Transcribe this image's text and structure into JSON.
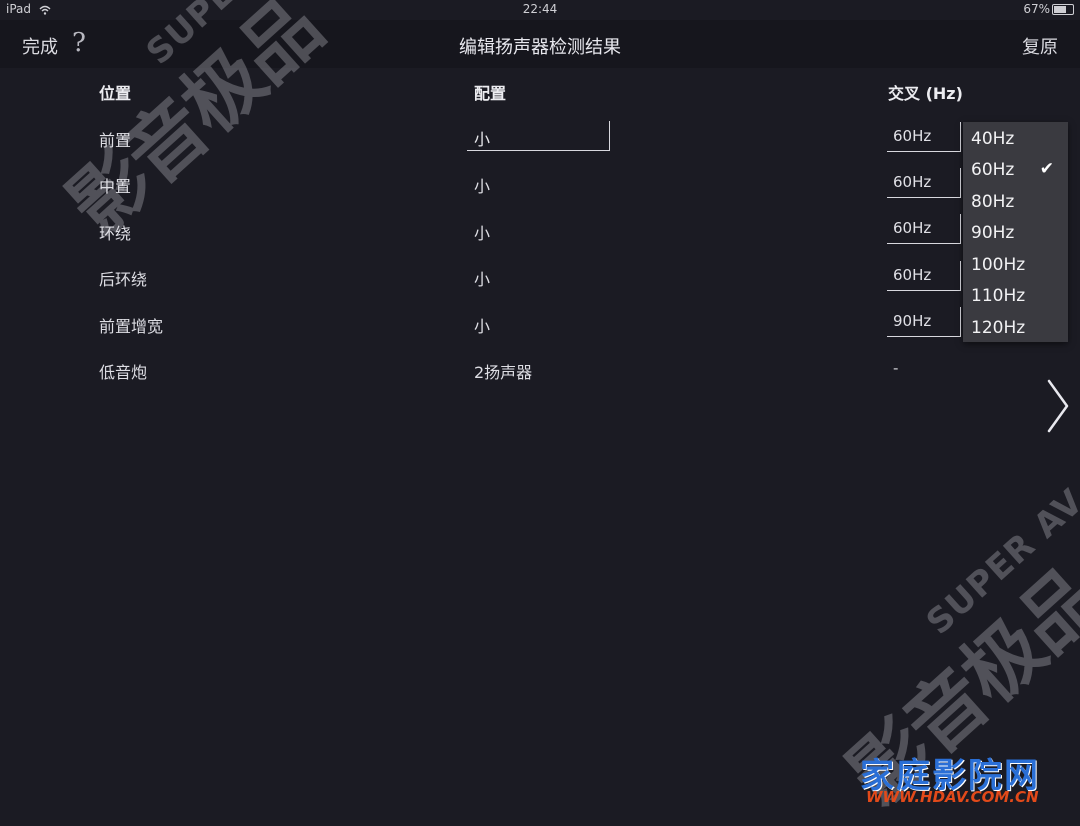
{
  "status_bar": {
    "device": "iPad",
    "time": "22:44",
    "battery": "67%"
  },
  "nav": {
    "done_label": "完成",
    "help_label": "?",
    "title": "编辑扬声器检测结果",
    "restore_label": "复原"
  },
  "columns": {
    "position": "位置",
    "config": "配置",
    "crossover": "交叉 (Hz)"
  },
  "rows": [
    {
      "position": "前置",
      "config": "小",
      "crossover": "60Hz"
    },
    {
      "position": "中置",
      "config": "小",
      "crossover": "60Hz"
    },
    {
      "position": "环绕",
      "config": "小",
      "crossover": "60Hz"
    },
    {
      "position": "后环绕",
      "config": "小",
      "crossover": "60Hz"
    },
    {
      "position": "前置增宽",
      "config": "小",
      "crossover": "90Hz"
    },
    {
      "position": "低音炮",
      "config": "2扬声器",
      "crossover": "-"
    }
  ],
  "crossover_dropdown": {
    "options": [
      "40Hz",
      "60Hz",
      "80Hz",
      "90Hz",
      "100Hz",
      "110Hz",
      "120Hz"
    ],
    "selected": "60Hz",
    "check_glyph": "✔"
  },
  "watermark": {
    "line1": "SUPER AV",
    "line2": "影音极品"
  },
  "site_logo": {
    "name": "家庭影院网",
    "url": "WWW.HDAV.COM.CN"
  },
  "icons": {
    "next": "chevron-right-icon",
    "wifi": "wifi-icon",
    "battery": "battery-icon"
  }
}
